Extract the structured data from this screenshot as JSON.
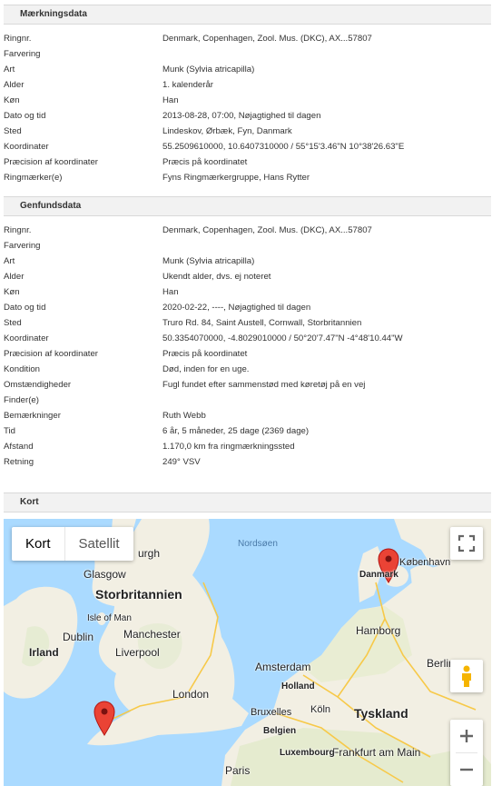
{
  "marking": {
    "title": "Mærkningsdata",
    "rows": [
      {
        "key": "Ringnr.",
        "value": "Denmark, Copenhagen, Zool. Mus. (DKC), AX...57807"
      },
      {
        "key": "Farvering",
        "value": ""
      },
      {
        "key": "Art",
        "value": "Munk (Sylvia atricapilla)"
      },
      {
        "key": "Alder",
        "value": "1. kalenderår"
      },
      {
        "key": "Køn",
        "value": "Han"
      },
      {
        "key": "Dato og tid",
        "value": "2013-08-28, 07:00, Nøjagtighed til dagen"
      },
      {
        "key": "Sted",
        "value": "Lindeskov, Ørbæk, Fyn, Danmark"
      },
      {
        "key": "Koordinater",
        "value": "55.2509610000, 10.6407310000 / 55°15'3.46\"N 10°38'26.63\"E"
      },
      {
        "key": "Præcision af koordinater",
        "value": "Præcis på koordinatet"
      },
      {
        "key": "Ringmærker(e)",
        "value": "Fyns Ringmærkergruppe, Hans Rytter"
      }
    ]
  },
  "recovery": {
    "title": "Genfundsdata",
    "rows": [
      {
        "key": "Ringnr.",
        "value": "Denmark, Copenhagen, Zool. Mus. (DKC), AX...57807"
      },
      {
        "key": "Farvering",
        "value": ""
      },
      {
        "key": "Art",
        "value": "Munk (Sylvia atricapilla)"
      },
      {
        "key": "Alder",
        "value": "Ukendt alder, dvs. ej noteret"
      },
      {
        "key": "Køn",
        "value": "Han"
      },
      {
        "key": "Dato og tid",
        "value": "2020-02-22, ----, Nøjagtighed til dagen"
      },
      {
        "key": "Sted",
        "value": "Truro Rd. 84, Saint Austell, Cornwall, Storbritannien"
      },
      {
        "key": "Koordinater",
        "value": "50.3354070000, -4.8029010000 / 50°20'7.47\"N -4°48'10.44\"W"
      },
      {
        "key": "Præcision af koordinater",
        "value": "Præcis på koordinatet"
      },
      {
        "key": "Kondition",
        "value": "Død, inden for en uge."
      },
      {
        "key": "Omstændigheder",
        "value": "Fugl fundet efter sammenstød med køretøj på en vej"
      },
      {
        "key": "Finder(e)",
        "value": ""
      },
      {
        "key": "Bemærkninger",
        "value": "Ruth Webb"
      },
      {
        "key": "Tid",
        "value": "6 år, 5 måneder, 25 dage (2369 dage)"
      },
      {
        "key": "Afstand",
        "value": "1.170,0 km fra ringmærkningssted"
      },
      {
        "key": "Retning",
        "value": "249° VSV"
      }
    ]
  },
  "map_section": {
    "title": "Kort",
    "map_type": {
      "map": "Kort",
      "satellite": "Satellit"
    },
    "icons": {
      "fullscreen": "fullscreen-icon",
      "pegman": "pegman-icon",
      "zoom_in": "plus-icon",
      "zoom_out": "minus-icon",
      "marker": "map-marker-icon"
    },
    "colors": {
      "water": "#aadaff",
      "land": "#f2efe3",
      "marker": "#ea4335",
      "park": "#cde6b9"
    },
    "labels": {
      "nordsoen": "Nordsøen",
      "storbritannien": "Storbritannien",
      "edinburgh": "urgh",
      "glasgow": "Glasgow",
      "isle_of_man": "Isle of Man",
      "dublin": "Dublin",
      "irland": "Irland",
      "manchester": "Manchester",
      "liverpool": "Liverpool",
      "london": "London",
      "danmark": "Danmark",
      "kobenhavn": "København",
      "hamborg": "Hamborg",
      "amsterdam": "Amsterdam",
      "holland": "Holland",
      "berlin": "Berlin",
      "tyskland": "Tyskland",
      "bruxelles": "Bruxelles",
      "belgien": "Belgien",
      "koln": "Köln",
      "luxembourg": "Luxembourg",
      "frankfurt": "Frankfurt am Main",
      "paris": "Paris"
    }
  }
}
